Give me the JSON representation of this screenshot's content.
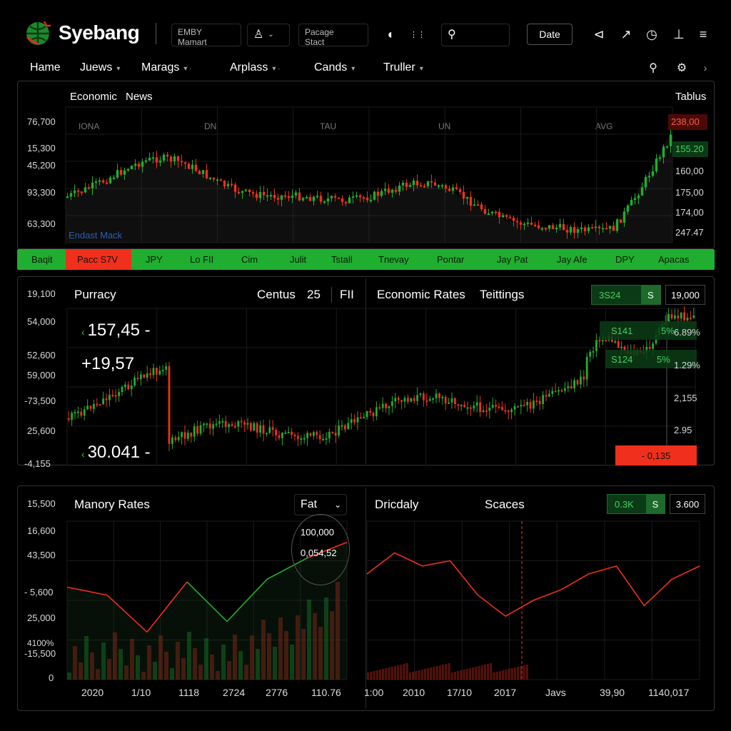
{
  "app": {
    "brand": "Syebang",
    "account_box": {
      "line1": "EMBY",
      "line2": "Mamart"
    },
    "package_box": {
      "line1": "Pacage",
      "line2": "Stact"
    },
    "date_button": "Date",
    "accent_green": "#1fae2f",
    "accent_red": "#f0301c"
  },
  "nav": [
    {
      "label": "Hame"
    },
    {
      "label": "Juews"
    },
    {
      "label": "Marags"
    },
    {
      "label": "Arplass"
    },
    {
      "label": "Cands"
    },
    {
      "label": "Truller"
    }
  ],
  "panel_top": {
    "tabs": [
      "Economic",
      "News"
    ],
    "right_label": "Tablus",
    "overlay_label": "Endast Mack",
    "column_labels": [
      "IONA",
      "DN",
      "TAU",
      "UN",
      "AVG"
    ],
    "y_left": [
      "76,700",
      "15,300",
      "45,200",
      "93,300",
      "63,300"
    ],
    "y_right": [
      "238,00",
      "155.20",
      "160,00",
      "175,00",
      "174,00",
      "247.47"
    ]
  },
  "ticker": [
    "Baqit",
    "Pacc S7V",
    "JPY",
    "Lo FII",
    "Cim",
    "Julit",
    "Tstall",
    "Tnevay",
    "Pontar",
    "Jay Pat",
    "Jay Afe",
    "DPY",
    "Apacas"
  ],
  "panel_mid": {
    "left_title": "Purracy",
    "left_centre": "Centus",
    "left_num": "25",
    "left_right": "FII",
    "right_title": "Economic Rates",
    "right_tab": "Teittings",
    "badge_value": "3S24",
    "badge_symbol": "S",
    "badge_box": "19,000",
    "big_values": [
      "157,45",
      "+19,57",
      "30.041"
    ],
    "y_left": [
      "19,100",
      "54,000",
      "52,600",
      "59,000",
      "-73,500",
      "25,600",
      "-4,155"
    ],
    "y_right": [
      "6.89%",
      "1.29%",
      "2,155",
      "2.95"
    ],
    "tags": [
      {
        "value": "S141",
        "pct": "5%"
      },
      {
        "value": "S124",
        "pct": "5%"
      }
    ],
    "red_tag": "- 0,135"
  },
  "panel_bot": {
    "left_title": "Manory Rates",
    "dropdown": "Fat",
    "bubble_top": "100,000",
    "bubble_bot": "0,054,52",
    "right_title": "Dricdaly",
    "right_tab": "Scaces",
    "badge_value": "0.3K",
    "badge_symbol": "S",
    "badge_box": "3.600",
    "y_left": [
      "15,500",
      "16,600",
      "43,500",
      "- 5,600",
      "25,000",
      "4100%",
      "-15,500",
      "0"
    ],
    "x_labels": [
      "2020",
      "1/10",
      "1118",
      "2724",
      "2776",
      "110.76",
      "1:00",
      "2010",
      "17/10",
      "2017",
      "Javs",
      "39,90",
      "1140,017"
    ]
  },
  "chart_data": [
    {
      "type": "line",
      "title": "Manory Rates",
      "x": [
        "2020",
        "1/10",
        "1118",
        "2724",
        "2776",
        "110.76"
      ],
      "series": [
        {
          "values": [
            25000,
            22000,
            8000,
            27000,
            12000,
            28000,
            36000,
            42000
          ]
        }
      ]
    },
    {
      "type": "line",
      "title": "Dricdaly",
      "x": [
        "1:00",
        "2010",
        "17/10",
        "2017",
        "Javs",
        "39,90",
        "1140,017"
      ],
      "series": [
        {
          "values": [
            30,
            38,
            33,
            35,
            22,
            14,
            20,
            24,
            30,
            33,
            18,
            28,
            33
          ]
        }
      ]
    }
  ]
}
